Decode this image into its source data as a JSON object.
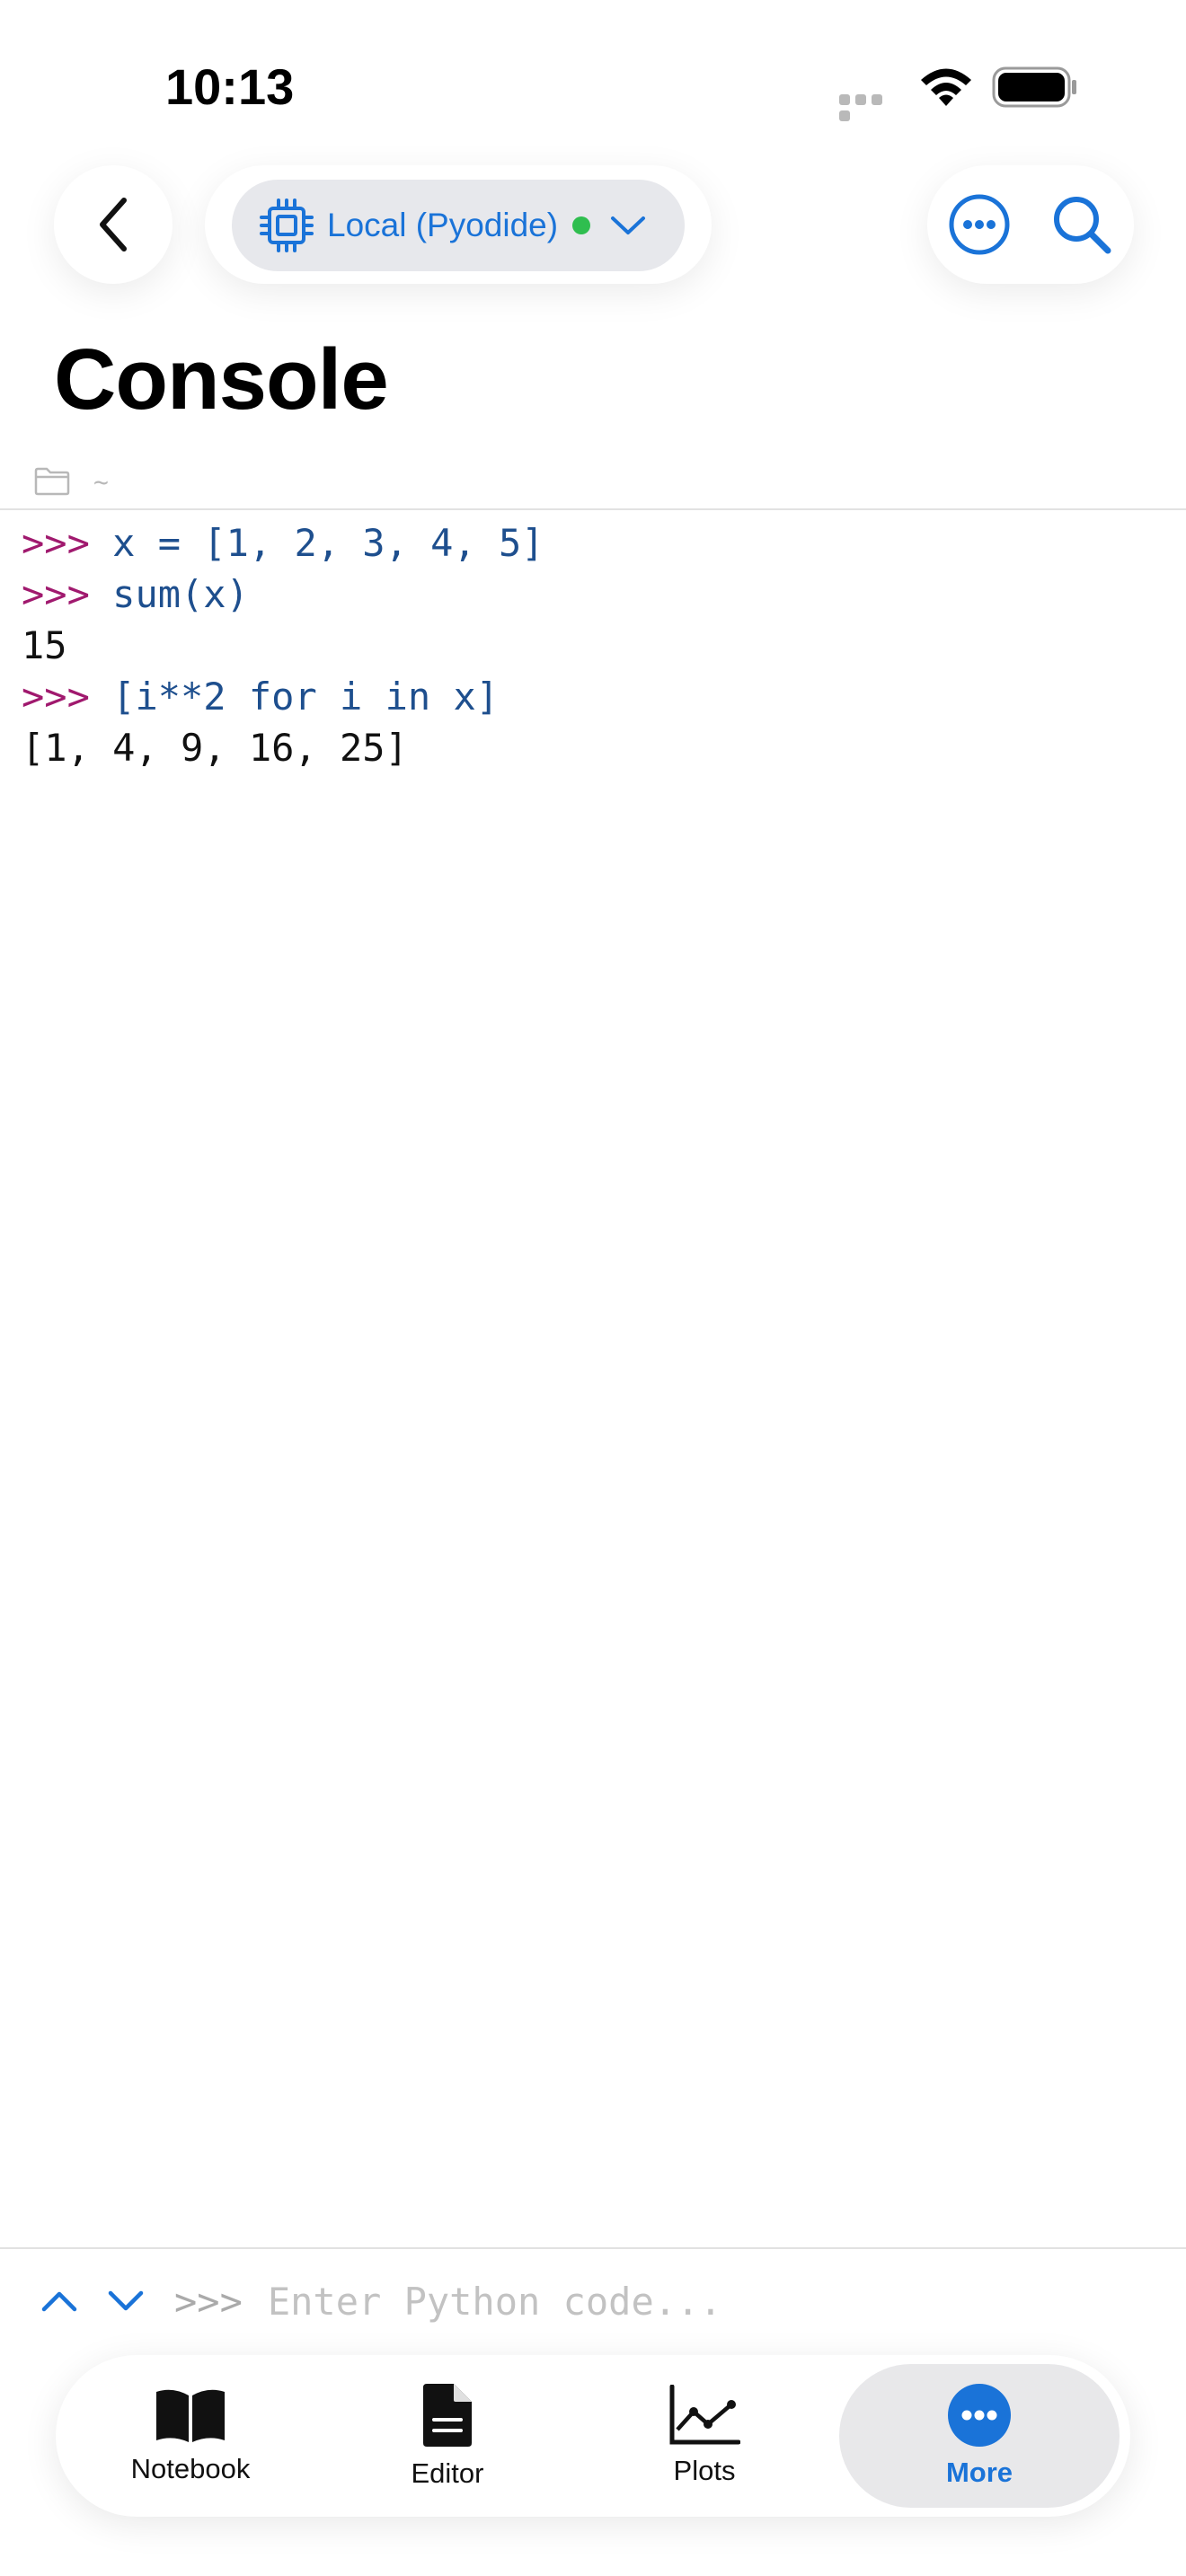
{
  "status_bar": {
    "time": "10:13"
  },
  "header": {
    "kernel_label": "Local (Pyodide)",
    "kernel_status_color": "#2fbe4f",
    "title": "Console",
    "cwd": "~"
  },
  "console": {
    "lines": [
      {
        "kind": "input",
        "prompt": ">>>",
        "text": "x = [1, 2, 3, 4, 5]"
      },
      {
        "kind": "input",
        "prompt": ">>>",
        "text": "sum(x)"
      },
      {
        "kind": "output",
        "text": "15"
      },
      {
        "kind": "input",
        "prompt": ">>>",
        "text": "[i**2 for i in x]"
      },
      {
        "kind": "output",
        "text": "[1, 4, 9, 16, 25]"
      }
    ]
  },
  "input_bar": {
    "prompt": ">>>",
    "placeholder": "Enter Python code..."
  },
  "tabs": [
    {
      "label": "Notebook",
      "icon": "book-icon"
    },
    {
      "label": "Editor",
      "icon": "document-icon"
    },
    {
      "label": "Plots",
      "icon": "chart-icon"
    },
    {
      "label": "More",
      "icon": "more-icon",
      "selected": true
    }
  ],
  "colors": {
    "accent": "#1a73d8",
    "prompt": "#a0196e",
    "code": "#1e4f8e"
  }
}
